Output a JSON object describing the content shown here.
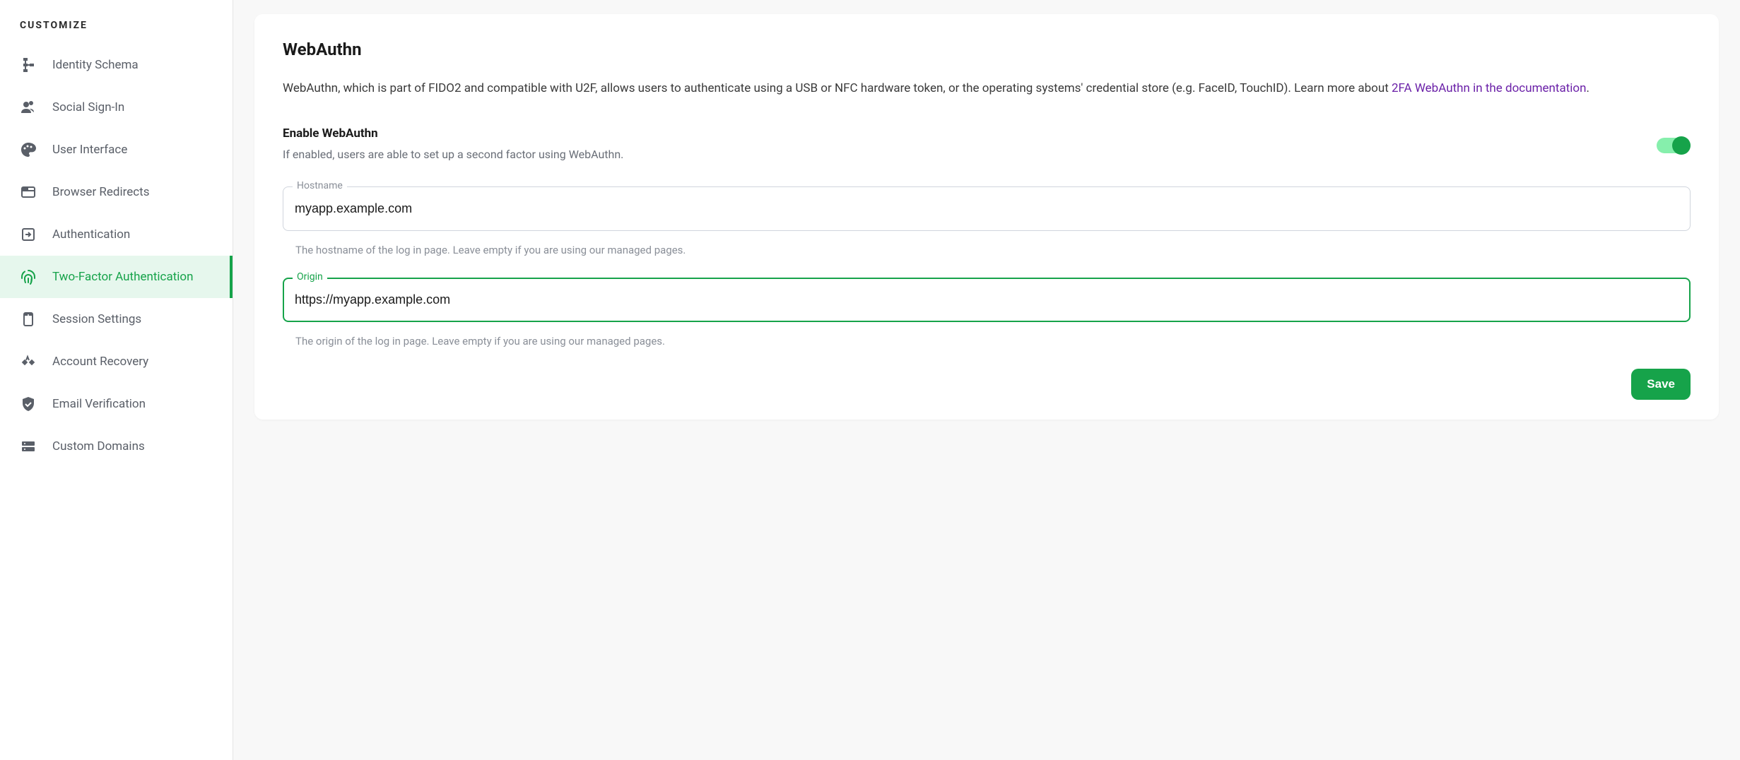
{
  "sidebar": {
    "header": "CUSTOMIZE",
    "items": [
      {
        "label": "Identity Schema",
        "icon": "schema"
      },
      {
        "label": "Social Sign-In",
        "icon": "users"
      },
      {
        "label": "User Interface",
        "icon": "palette"
      },
      {
        "label": "Browser Redirects",
        "icon": "browser"
      },
      {
        "label": "Authentication",
        "icon": "login"
      },
      {
        "label": "Two-Factor Authentication",
        "icon": "fingerprint",
        "active": true
      },
      {
        "label": "Session Settings",
        "icon": "device"
      },
      {
        "label": "Account Recovery",
        "icon": "recovery"
      },
      {
        "label": "Email Verification",
        "icon": "shield"
      },
      {
        "label": "Custom Domains",
        "icon": "server"
      }
    ]
  },
  "card": {
    "title": "WebAuthn",
    "description_pre": "WebAuthn, which is part of FIDO2 and compatible with U2F, allows users to authenticate using a USB or NFC hardware token, or the operating systems' credential store (e.g. FaceID, TouchID). Learn more about ",
    "description_link": "2FA WebAuthn in the documentation",
    "description_post": ".",
    "toggle": {
      "label": "Enable WebAuthn",
      "help": "If enabled, users are able to set up a second factor using WebAuthn.",
      "enabled": true
    },
    "fields": {
      "hostname": {
        "label": "Hostname",
        "value": "myapp.example.com",
        "help": "The hostname of the log in page. Leave empty if you are using our managed pages."
      },
      "origin": {
        "label": "Origin",
        "value": "https://myapp.example.com",
        "help": "The origin of the log in page. Leave empty if you are using our managed pages.",
        "focused": true
      }
    },
    "save_label": "Save"
  }
}
